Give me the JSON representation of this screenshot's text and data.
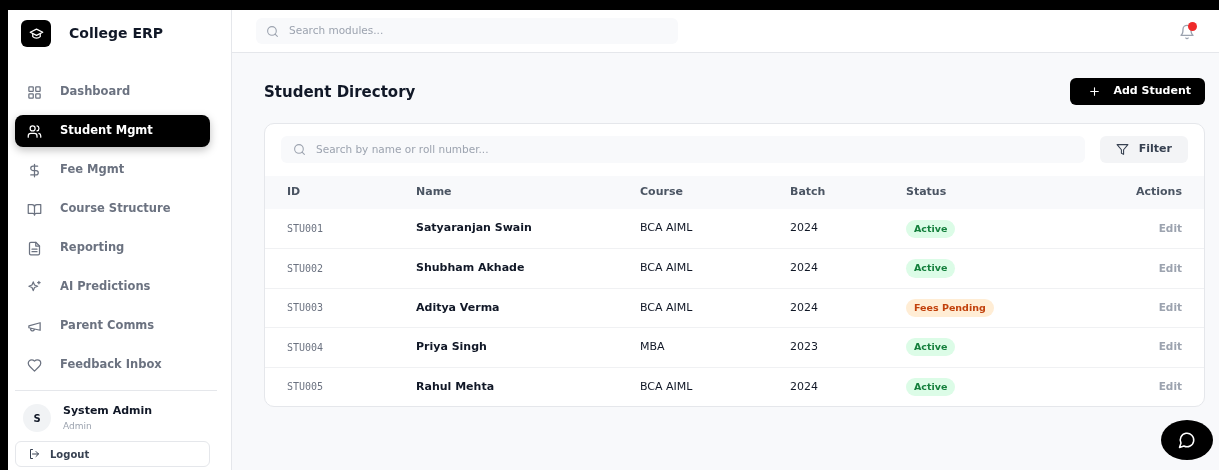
{
  "brand": {
    "title": "College ERP"
  },
  "sidebar": {
    "items": [
      {
        "label": "Dashboard",
        "selected": false
      },
      {
        "label": "Student Mgmt",
        "selected": true
      },
      {
        "label": "Fee Mgmt",
        "selected": false
      },
      {
        "label": "Course Structure",
        "selected": false
      },
      {
        "label": "Reporting",
        "selected": false
      },
      {
        "label": "AI Predictions",
        "selected": false
      },
      {
        "label": "Parent Comms",
        "selected": false
      },
      {
        "label": "Feedback Inbox",
        "selected": false
      }
    ],
    "user": {
      "initial": "S",
      "name": "System Admin",
      "role": "Admin"
    },
    "logout": "Logout"
  },
  "header": {
    "search": {
      "placeholder": "Search modules..."
    },
    "notifications": {
      "unread": true
    }
  },
  "page": {
    "title": "Student Directory",
    "add_button": "Add Student"
  },
  "table": {
    "search": {
      "placeholder": "Search by name or roll number..."
    },
    "filter_button": "Filter",
    "columns": [
      "ID",
      "Name",
      "Course",
      "Batch",
      "Status",
      "Actions"
    ],
    "rows": [
      {
        "id": "STU001",
        "name": "Satyaranjan Swain",
        "course": "BCA AIML",
        "batch": "2024",
        "status": {
          "label": "Active",
          "kind": "active"
        },
        "action": "Edit"
      },
      {
        "id": "STU002",
        "name": "Shubham Akhade",
        "course": "BCA AIML",
        "batch": "2024",
        "status": {
          "label": "Active",
          "kind": "active"
        },
        "action": "Edit"
      },
      {
        "id": "STU003",
        "name": "Aditya Verma",
        "course": "BCA AIML",
        "batch": "2024",
        "status": {
          "label": "Fees Pending",
          "kind": "pending"
        },
        "action": "Edit"
      },
      {
        "id": "STU004",
        "name": "Priya Singh",
        "course": "MBA",
        "batch": "2023",
        "status": {
          "label": "Active",
          "kind": "active"
        },
        "action": "Edit"
      },
      {
        "id": "STU005",
        "name": "Rahul Mehta",
        "course": "BCA AIML",
        "batch": "2024",
        "status": {
          "label": "Active",
          "kind": "active"
        },
        "action": "Edit"
      }
    ]
  }
}
